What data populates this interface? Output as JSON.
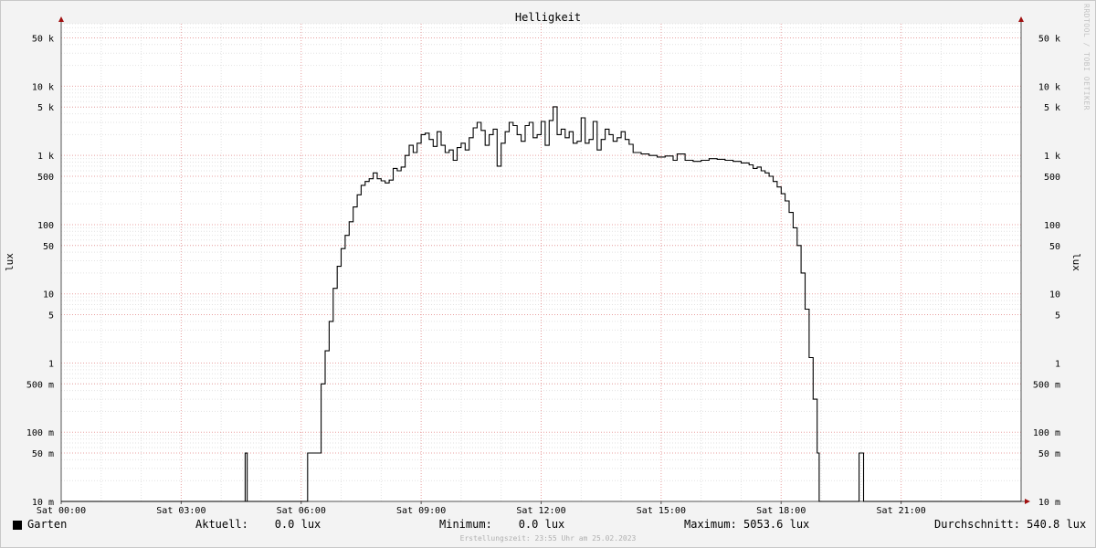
{
  "chart_data": {
    "type": "line",
    "title": "Helligkeit",
    "ylabel": "lux",
    "ylabel_right": "lux",
    "yscale": "log",
    "ylim": [
      0.01,
      80000
    ],
    "x_ticks": [
      "Sat 00:00",
      "Sat 03:00",
      "Sat 06:00",
      "Sat 09:00",
      "Sat 12:00",
      "Sat 15:00",
      "Sat 18:00",
      "Sat 21:00"
    ],
    "y_ticks": [
      {
        "value": 50000,
        "label": "50 k"
      },
      {
        "value": 10000,
        "label": "10 k"
      },
      {
        "value": 5000,
        "label": "5 k"
      },
      {
        "value": 1000,
        "label": "1 k"
      },
      {
        "value": 500,
        "label": "500"
      },
      {
        "value": 100,
        "label": "100"
      },
      {
        "value": 50,
        "label": "50"
      },
      {
        "value": 10,
        "label": "10"
      },
      {
        "value": 5,
        "label": "5"
      },
      {
        "value": 1,
        "label": "1"
      },
      {
        "value": 0.5,
        "label": "500 m"
      },
      {
        "value": 0.1,
        "label": "100 m"
      },
      {
        "value": 0.05,
        "label": "50 m"
      },
      {
        "value": 0.01,
        "label": "10 m"
      }
    ],
    "grid": true,
    "series": [
      {
        "name": "Garten",
        "color": "#000000",
        "points": [
          [
            0.0,
            0.01
          ],
          [
            6.15,
            0.01
          ],
          [
            6.16,
            0.05
          ],
          [
            6.45,
            0.05
          ],
          [
            6.5,
            0.5
          ],
          [
            6.6,
            1.5
          ],
          [
            6.7,
            4
          ],
          [
            6.8,
            12
          ],
          [
            6.9,
            25
          ],
          [
            7.0,
            45
          ],
          [
            7.1,
            70
          ],
          [
            7.2,
            110
          ],
          [
            7.3,
            180
          ],
          [
            7.4,
            270
          ],
          [
            7.5,
            370
          ],
          [
            7.6,
            420
          ],
          [
            7.7,
            460
          ],
          [
            7.8,
            560
          ],
          [
            7.9,
            460
          ],
          [
            8.0,
            430
          ],
          [
            8.1,
            400
          ],
          [
            8.2,
            440
          ],
          [
            8.3,
            650
          ],
          [
            8.4,
            600
          ],
          [
            8.5,
            680
          ],
          [
            8.6,
            1000
          ],
          [
            8.7,
            1400
          ],
          [
            8.8,
            1100
          ],
          [
            8.9,
            1500
          ],
          [
            9.0,
            2000
          ],
          [
            9.1,
            2100
          ],
          [
            9.2,
            1700
          ],
          [
            9.3,
            1350
          ],
          [
            9.4,
            2200
          ],
          [
            9.5,
            1400
          ],
          [
            9.6,
            1100
          ],
          [
            9.7,
            1200
          ],
          [
            9.8,
            850
          ],
          [
            9.9,
            1300
          ],
          [
            10.0,
            1500
          ],
          [
            10.1,
            1200
          ],
          [
            10.2,
            1800
          ],
          [
            10.3,
            2500
          ],
          [
            10.4,
            3000
          ],
          [
            10.5,
            2300
          ],
          [
            10.6,
            1400
          ],
          [
            10.7,
            2000
          ],
          [
            10.8,
            2400
          ],
          [
            10.9,
            700
          ],
          [
            11.0,
            1500
          ],
          [
            11.1,
            2200
          ],
          [
            11.2,
            3000
          ],
          [
            11.3,
            2700
          ],
          [
            11.4,
            2000
          ],
          [
            11.5,
            1600
          ],
          [
            11.6,
            2700
          ],
          [
            11.7,
            3000
          ],
          [
            11.8,
            1800
          ],
          [
            11.9,
            2000
          ],
          [
            12.0,
            3100
          ],
          [
            12.1,
            1400
          ],
          [
            12.2,
            3200
          ],
          [
            12.3,
            5054
          ],
          [
            12.4,
            2000
          ],
          [
            12.5,
            2400
          ],
          [
            12.6,
            1800
          ],
          [
            12.7,
            2200
          ],
          [
            12.8,
            1500
          ],
          [
            12.9,
            1600
          ],
          [
            13.0,
            3500
          ],
          [
            13.1,
            1500
          ],
          [
            13.2,
            1700
          ],
          [
            13.3,
            3100
          ],
          [
            13.4,
            1200
          ],
          [
            13.5,
            1700
          ],
          [
            13.6,
            2400
          ],
          [
            13.7,
            2000
          ],
          [
            13.8,
            1600
          ],
          [
            13.9,
            1800
          ],
          [
            14.0,
            2200
          ],
          [
            14.1,
            1700
          ],
          [
            14.2,
            1450
          ],
          [
            14.3,
            1100
          ],
          [
            14.5,
            1050
          ],
          [
            14.7,
            1000
          ],
          [
            14.9,
            950
          ],
          [
            15.1,
            980
          ],
          [
            15.3,
            850
          ],
          [
            15.4,
            1050
          ],
          [
            15.6,
            850
          ],
          [
            15.8,
            820
          ],
          [
            16.0,
            850
          ],
          [
            16.2,
            900
          ],
          [
            16.4,
            880
          ],
          [
            16.6,
            850
          ],
          [
            16.8,
            820
          ],
          [
            17.0,
            780
          ],
          [
            17.2,
            730
          ],
          [
            17.3,
            650
          ],
          [
            17.4,
            680
          ],
          [
            17.5,
            600
          ],
          [
            17.6,
            560
          ],
          [
            17.7,
            500
          ],
          [
            17.8,
            420
          ],
          [
            17.9,
            350
          ],
          [
            18.0,
            280
          ],
          [
            18.1,
            220
          ],
          [
            18.2,
            150
          ],
          [
            18.3,
            90
          ],
          [
            18.4,
            50
          ],
          [
            18.5,
            20
          ],
          [
            18.6,
            6
          ],
          [
            18.7,
            1.2
          ],
          [
            18.8,
            0.3
          ],
          [
            18.9,
            0.05
          ],
          [
            18.95,
            0.01
          ],
          [
            19.9,
            0.01
          ],
          [
            19.95,
            0.05
          ],
          [
            20.05,
            0.05
          ],
          [
            20.06,
            0.01
          ],
          [
            24.0,
            0.01
          ]
        ],
        "spikes": [
          [
            4.6,
            0.05
          ]
        ]
      }
    ],
    "legend": {
      "label": "Garten",
      "current": "Aktuell:    0.0 lux",
      "minimum": "Minimum:    0.0 lux",
      "maximum": "Maximum: 5053.6 lux",
      "average": "Durchschnitt: 540.8 lux"
    },
    "footer": "Erstellungszeit: 23:55 Uhr am 25.02.2023",
    "watermark": "RRDTOOL / TOBI OETIKER"
  }
}
